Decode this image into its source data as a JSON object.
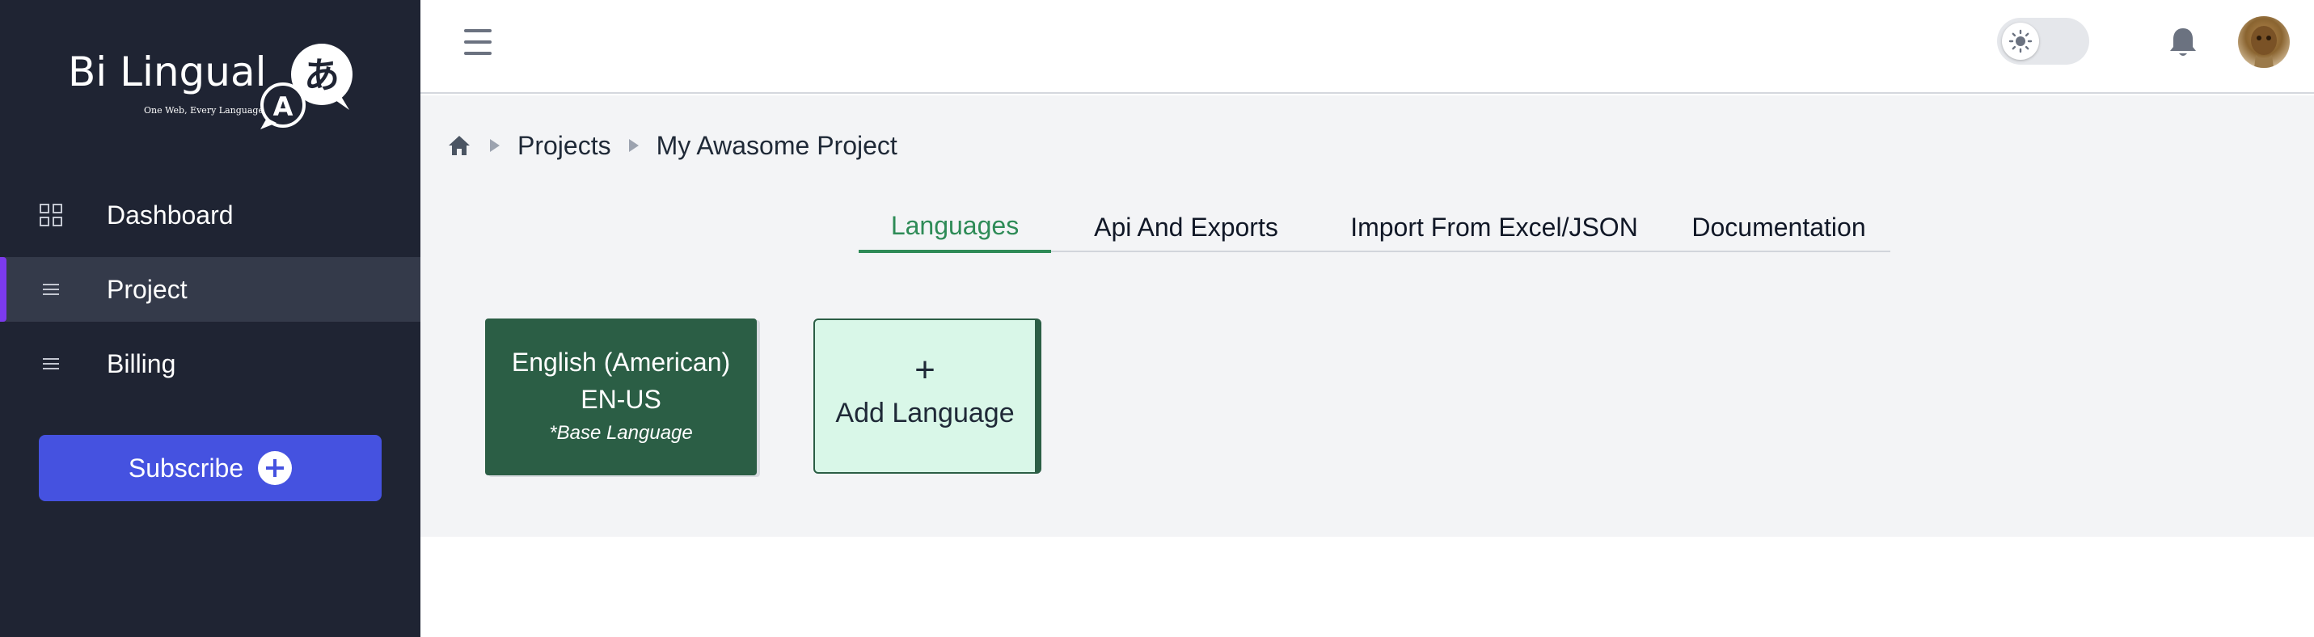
{
  "app": {
    "logo_text": "Bi Lingual",
    "logo_tagline": "One Web, Every Language",
    "logo_glyph_a": "A",
    "logo_glyph_jp": "あ"
  },
  "sidebar": {
    "items": [
      {
        "label": "Dashboard",
        "icon": "grid-icon"
      },
      {
        "label": "Project",
        "icon": "list-icon",
        "active": true
      },
      {
        "label": "Billing",
        "icon": "list-icon"
      }
    ],
    "subscribe_label": "Subscribe"
  },
  "header": {
    "theme_toggle_on": false,
    "icons": [
      "hamburger-icon",
      "sun-icon",
      "bell-icon",
      "avatar"
    ]
  },
  "breadcrumb": {
    "items": [
      "Projects",
      "My Awasome Project"
    ]
  },
  "tabs": [
    {
      "label": "Languages",
      "active": true
    },
    {
      "label": "Api And Exports"
    },
    {
      "label": "Import From Excel/JSON"
    },
    {
      "label": "Documentation"
    }
  ],
  "languages": [
    {
      "name": "English (American)",
      "code": "EN-US",
      "note": "*Base Language"
    }
  ],
  "add_language": {
    "symbol": "+",
    "label": "Add Language"
  },
  "colors": {
    "sidebar_bg": "#1f2433",
    "accent_green": "#2e8b57",
    "card_green": "#2b5e45",
    "subscribe_blue": "#4552e0",
    "active_indicator": "#7c3aed"
  }
}
